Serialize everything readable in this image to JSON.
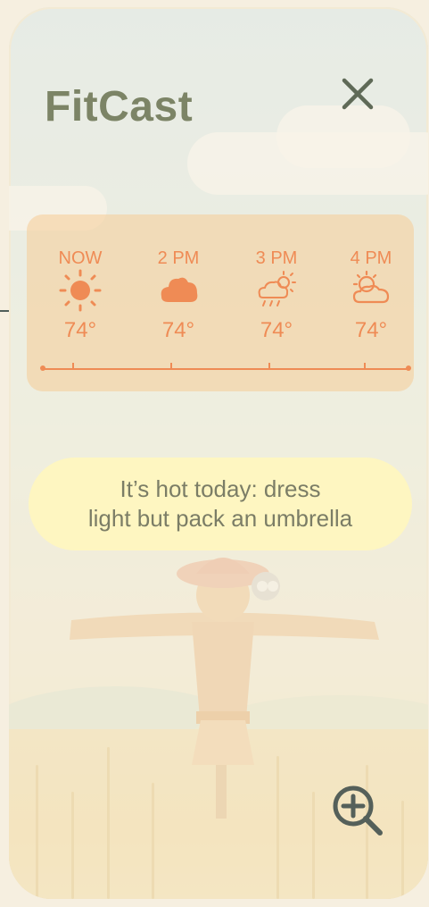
{
  "app": {
    "title": "FitCast"
  },
  "forecast": {
    "hours": [
      {
        "label": "NOW",
        "temp": "74°",
        "icon": "sun-icon"
      },
      {
        "label": "2 PM",
        "temp": "74°",
        "icon": "cloud-icon"
      },
      {
        "label": "3 PM",
        "temp": "74°",
        "icon": "sun-cloud-rain-icon"
      },
      {
        "label": "4 PM",
        "temp": "74°",
        "icon": "partly-cloudy-icon"
      }
    ],
    "accent_color": "#ef8b55"
  },
  "tip": {
    "line1": "It’s hot today: dress",
    "line2": "light but pack an umbrella"
  },
  "icons": {
    "close": "close-icon",
    "zoom": "zoom-in-icon"
  }
}
